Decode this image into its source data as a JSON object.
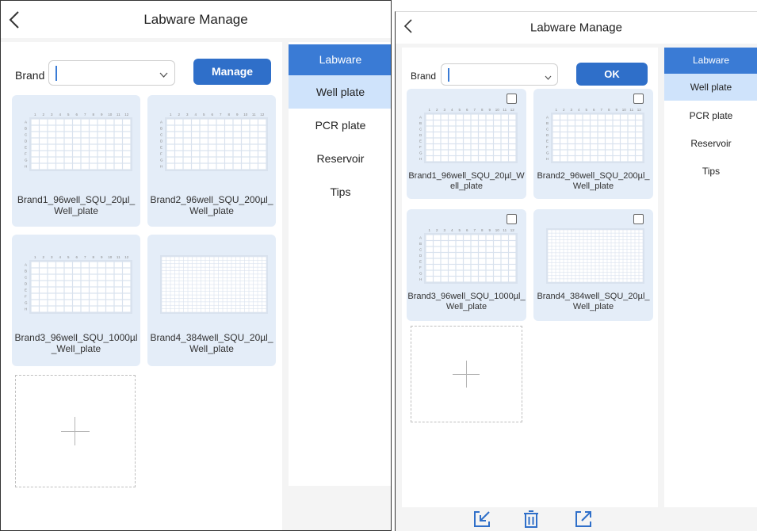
{
  "left_screen": {
    "header": {
      "title": "Labware Manage"
    },
    "sidebar": {
      "items": [
        {
          "label": "Labware"
        },
        {
          "label": "Well plate"
        },
        {
          "label": "PCR plate"
        },
        {
          "label": "Reservoir"
        },
        {
          "label": "Tips"
        }
      ]
    },
    "filter": {
      "brand_label": "Brand",
      "brand_value": "",
      "action_label": "Manage"
    },
    "cards": [
      {
        "name": "Brand1_96well_SQU_20µl_Well_plate",
        "wells": 96
      },
      {
        "name": "Brand2_96well_SQU_200µl_Well_plate",
        "wells": 96
      },
      {
        "name": "Brand3_96well_SQU_1000µl_Well_plate",
        "wells": 96
      },
      {
        "name": "Brand4_384well_SQU_20µl_Well_plate",
        "wells": 384
      }
    ]
  },
  "right_screen": {
    "header": {
      "title": "Labware Manage"
    },
    "sidebar": {
      "items": [
        {
          "label": "Labware"
        },
        {
          "label": "Well plate"
        },
        {
          "label": "PCR plate"
        },
        {
          "label": "Reservoir"
        },
        {
          "label": "Tips"
        }
      ]
    },
    "filter": {
      "brand_label": "Brand",
      "brand_value": "",
      "action_label": "OK"
    },
    "cards": [
      {
        "name": "Brand1_96well_SQU_20µl_Well_plate",
        "wells": 96,
        "checked": false
      },
      {
        "name": "Brand2_96well_SQU_200µl_Well_plate",
        "wells": 96,
        "checked": false
      },
      {
        "name": "Brand3_96well_SQU_1000µl_Well_plate",
        "wells": 96,
        "checked": false
      },
      {
        "name": "Brand4_384well_SQU_20µl_Well_plate",
        "wells": 384,
        "checked": false
      }
    ],
    "bottom_toolbar": {
      "icons": [
        "import-icon",
        "trash-icon",
        "export-icon"
      ]
    }
  },
  "plate_labels": {
    "columns": [
      "1",
      "2",
      "3",
      "4",
      "5",
      "6",
      "7",
      "8",
      "9",
      "10",
      "11",
      "12"
    ],
    "rows": [
      "A",
      "B",
      "C",
      "D",
      "E",
      "F",
      "G",
      "H"
    ]
  },
  "colors": {
    "accent": "#3a7bd5",
    "button": "#2f6fc9",
    "selected_bg": "#cfe3fb",
    "card_bg": "#e4edf8",
    "content_bg": "#f4f4f4"
  }
}
